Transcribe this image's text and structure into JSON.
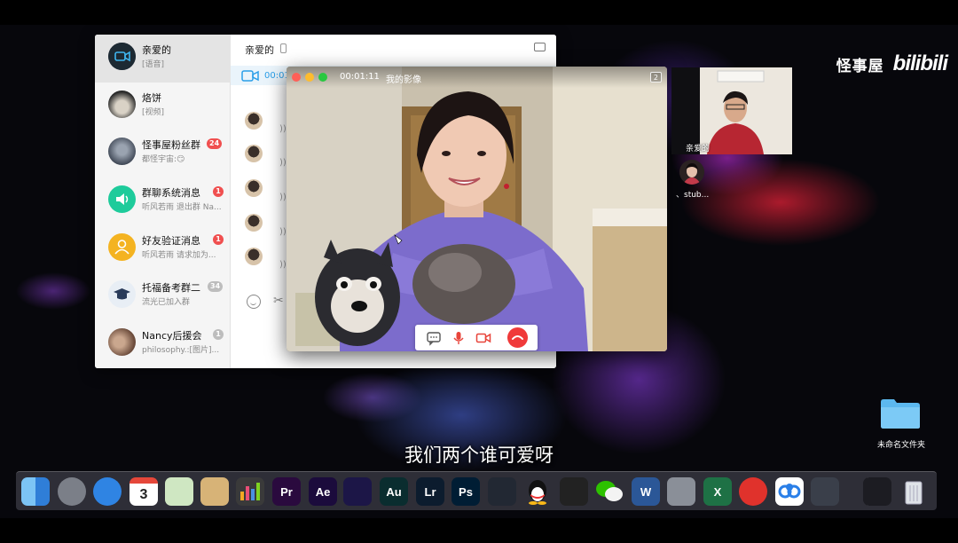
{
  "watermark": {
    "channel": "怪事屋",
    "logo": "bilibili"
  },
  "chat_window": {
    "conversations": [
      {
        "name": "亲爱的",
        "preview": "[语音]",
        "badge": ""
      },
      {
        "name": "烙饼",
        "preview": "[视频]",
        "badge": ""
      },
      {
        "name": "怪事屋粉丝群",
        "preview": "都怪宇宙:😏",
        "badge": "24"
      },
      {
        "name": "群聊系统消息",
        "preview": "听风若雨 退出群 Na...",
        "badge": "1"
      },
      {
        "name": "好友验证消息",
        "preview": "听风若雨 请求加为...",
        "badge": "1"
      },
      {
        "name": "托福备考群二",
        "preview": "流光已加入群",
        "badge": "34"
      },
      {
        "name": "Nancy后援会",
        "preview": "philosophy.:[图片]...",
        "badge": "1"
      }
    ],
    "current_chat": {
      "title": "亲爱的",
      "call_time": "00:01"
    }
  },
  "video_call": {
    "timer": "00:01:11",
    "title": "我的影像",
    "participant_count": "2"
  },
  "remote": {
    "participant_name": "亲爱的",
    "participant2_name": "、stub..."
  },
  "desktop": {
    "folder_label": "未命名文件夹"
  },
  "subtitle": "我们两个谁可爱呀",
  "dock": {
    "apps": [
      {
        "name": "finder-icon",
        "label": "",
        "bg": "#3c9be8"
      },
      {
        "name": "launchpad-icon",
        "label": "",
        "bg": "#7b7f88"
      },
      {
        "name": "safari-icon",
        "label": "",
        "bg": "#2f84e3"
      },
      {
        "name": "calendar-icon",
        "label": "3",
        "bg": "#ffffff"
      },
      {
        "name": "maps-icon",
        "label": "",
        "bg": "#cfe7c2"
      },
      {
        "name": "preview-icon",
        "label": "",
        "bg": "#d7b377"
      },
      {
        "name": "keynote-chart-icon",
        "label": "",
        "bg": "#3a3a3a"
      },
      {
        "name": "premiere-icon",
        "label": "Pr",
        "bg": "#2a0a3e"
      },
      {
        "name": "after-effects-icon",
        "label": "Ae",
        "bg": "#1b0b3c"
      },
      {
        "name": "media-encoder-icon",
        "label": "",
        "bg": "#1c1647"
      },
      {
        "name": "audition-icon",
        "label": "Au",
        "bg": "#0a2d2f"
      },
      {
        "name": "lightroom-icon",
        "label": "Lr",
        "bg": "#0c1c2e"
      },
      {
        "name": "photoshop-icon",
        "label": "Ps",
        "bg": "#001d34"
      },
      {
        "name": "davinci-resolve-icon",
        "label": "",
        "bg": "#222833"
      },
      {
        "name": "qq-icon",
        "label": "",
        "bg": "transparent"
      },
      {
        "name": "final-cut-icon",
        "label": "",
        "bg": "#222"
      },
      {
        "name": "wechat-icon",
        "label": "",
        "bg": "transparent"
      },
      {
        "name": "word-icon",
        "label": "W",
        "bg": "#2b5797"
      },
      {
        "name": "system-preferences-icon",
        "label": "",
        "bg": "#8a8f98"
      },
      {
        "name": "excel-icon",
        "label": "X",
        "bg": "#1e7145"
      },
      {
        "name": "netease-music-icon",
        "label": "",
        "bg": "#e0322c"
      },
      {
        "name": "baidu-netdisk-icon",
        "label": "",
        "bg": "#ffffff"
      },
      {
        "name": "quicktime-icon",
        "label": "",
        "bg": "#3a3f4a"
      },
      {
        "name": "screenshot-folder-icon",
        "label": "",
        "bg": "#1c1c22"
      },
      {
        "name": "trash-icon",
        "label": "",
        "bg": "transparent"
      }
    ]
  }
}
